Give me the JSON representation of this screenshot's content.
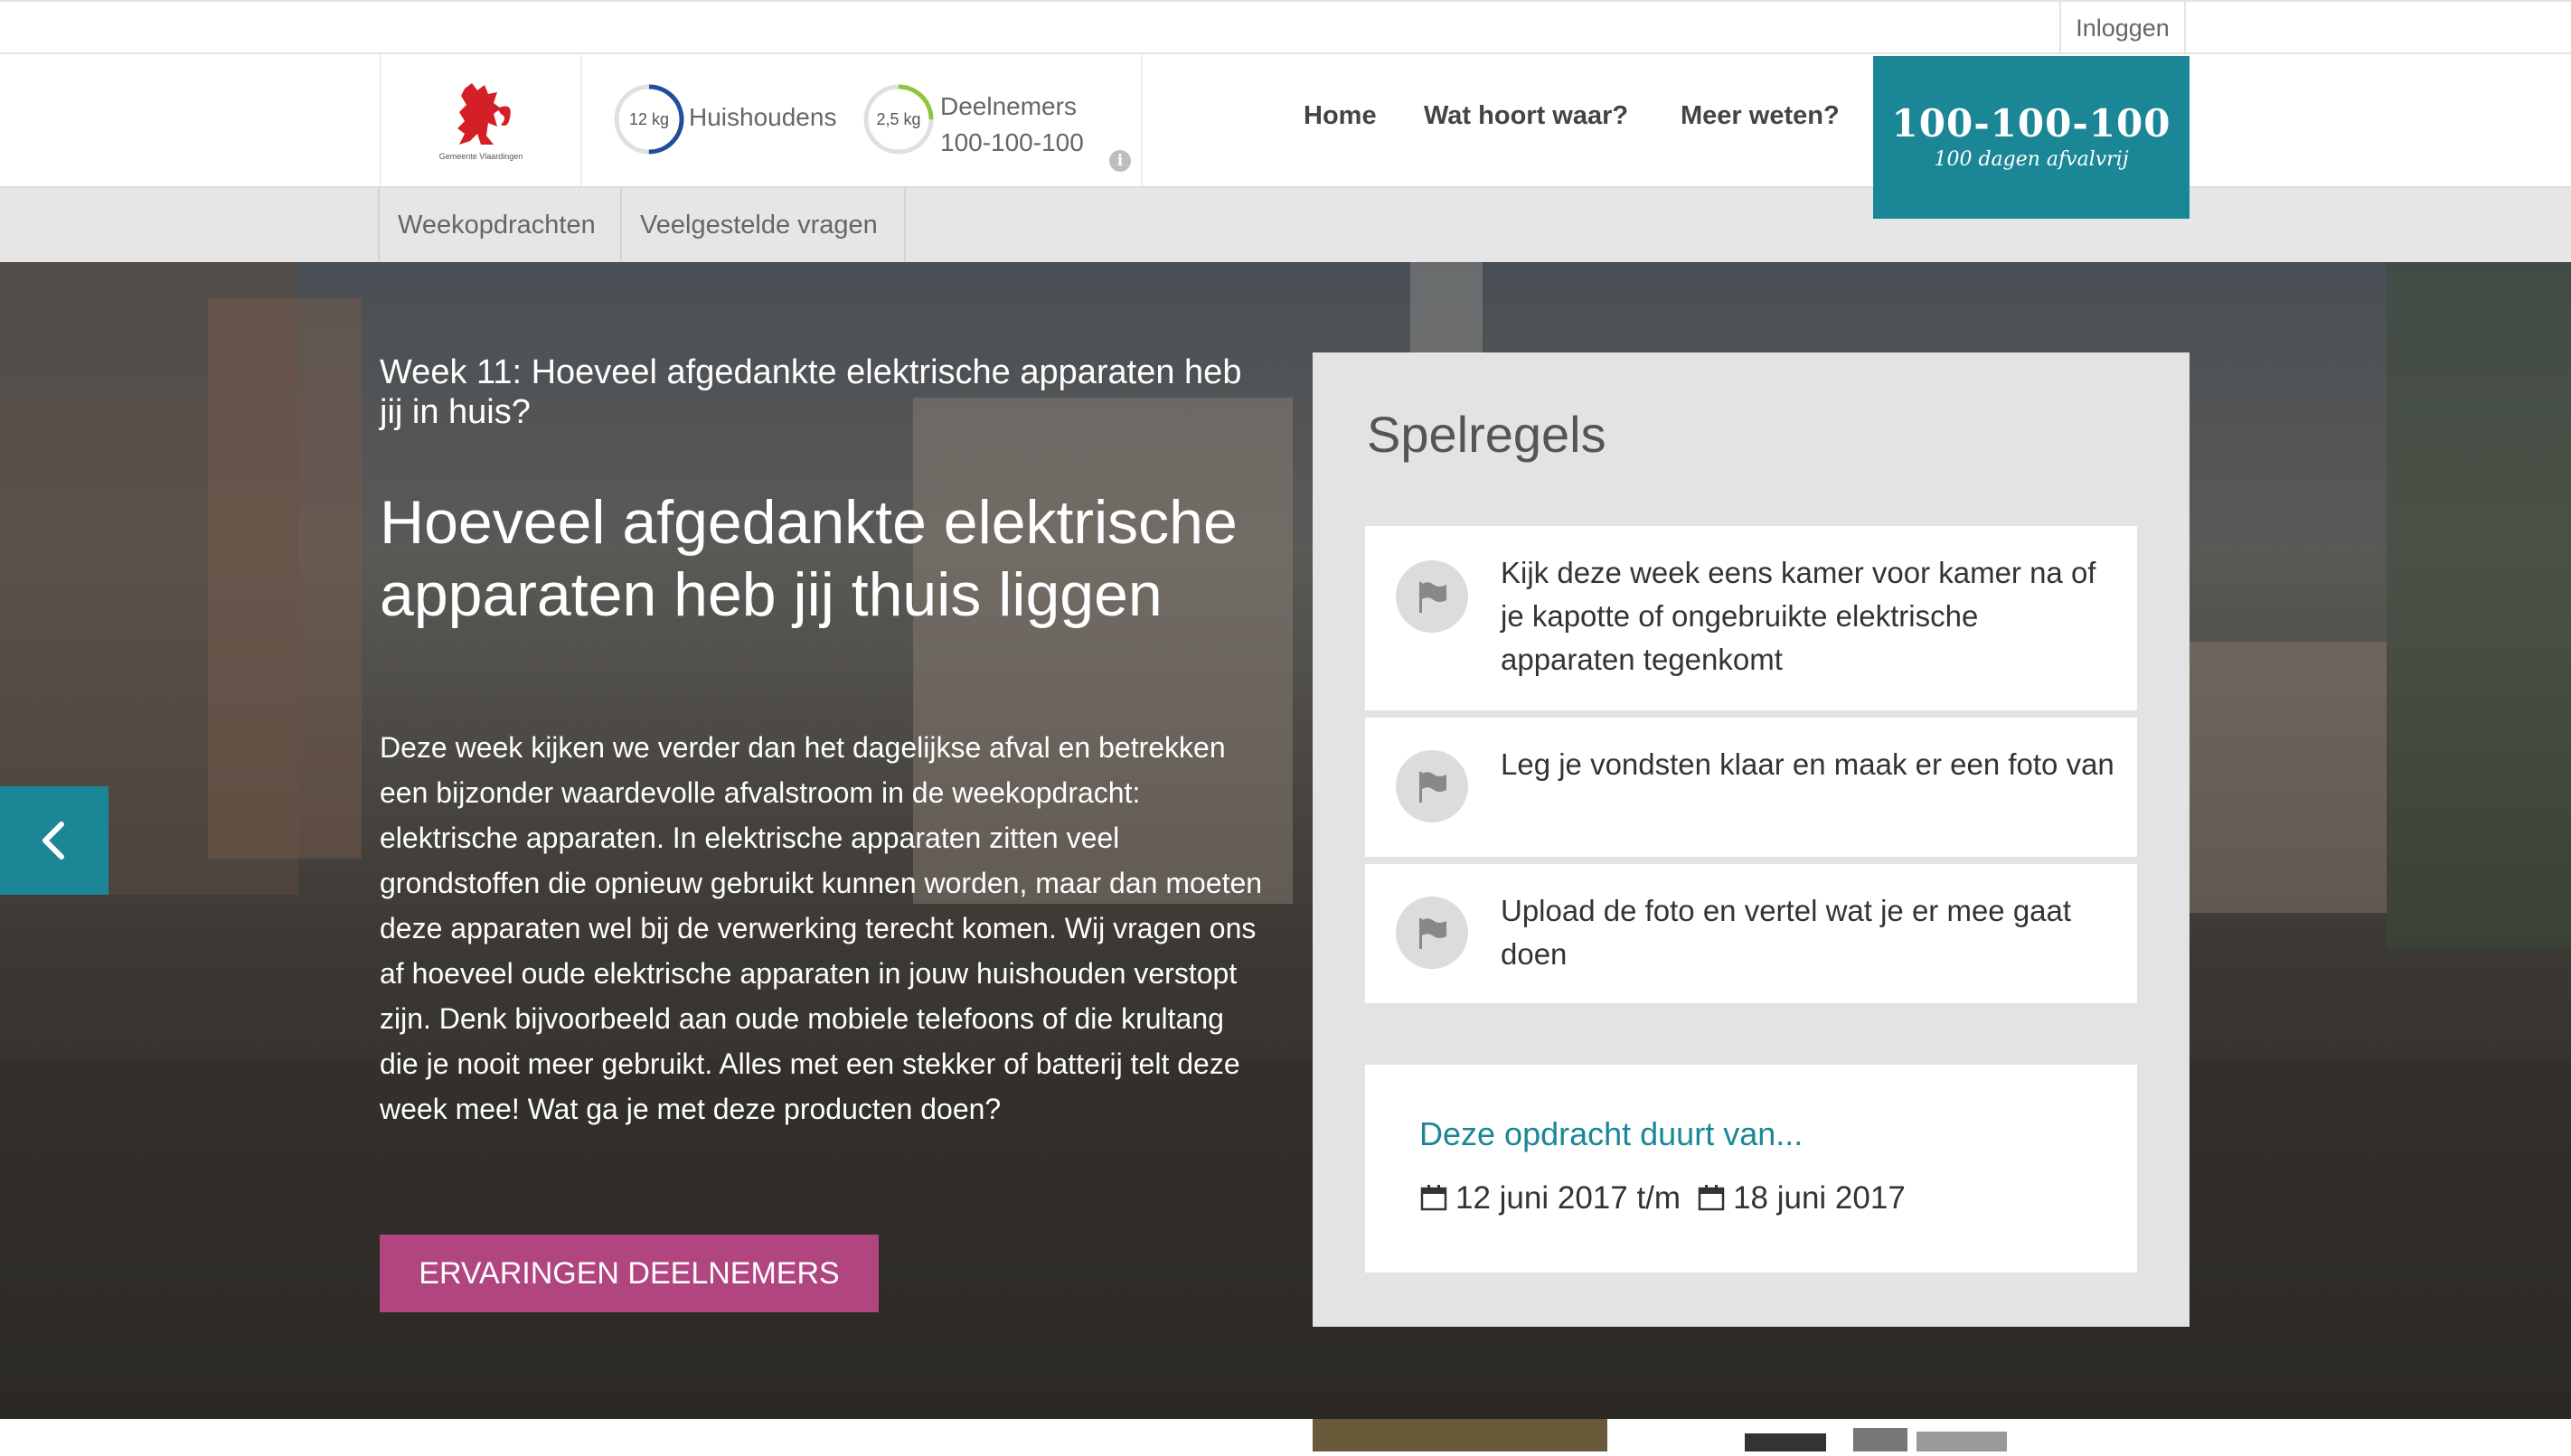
{
  "topbar": {
    "login": "Inloggen"
  },
  "header": {
    "logo_caption": "Gemeente Vlaardingen",
    "stats": [
      {
        "value": "12 kg",
        "label": "Huishoudens",
        "sub": "",
        "progress": 0.5,
        "color": "#1f4e9c"
      },
      {
        "value": "2,5 kg",
        "label": "Deelnemers",
        "sub": "100-100-100",
        "progress": 0.25,
        "color": "#8dc63f"
      }
    ],
    "info_icon": "info-icon",
    "nav": [
      "Home",
      "Wat hoort waar?",
      "Meer weten?"
    ],
    "brand": {
      "title": "100-100-100",
      "subtitle": "100 dagen afvalvrij",
      "color": "#1b8796"
    }
  },
  "subnav": [
    "Weekopdrachten",
    "Veelgestelde vragen"
  ],
  "hero": {
    "week_title": "Week 11: Hoeveel afgedankte elektrische apparaten heb jij in huis?",
    "heading": "Hoeveel afgedankte elektrische apparaten heb jij thuis liggen",
    "body": "Deze week kijken we verder dan het dagelijkse afval en betrekken een bijzonder waardevolle afvalstroom in de weekopdracht: elektrische apparaten. In elektrische apparaten zitten veel grondstoffen die opnieuw gebruikt kunnen worden, maar dan moeten deze apparaten wel bij de verwerking terecht komen. Wij vragen ons af hoeveel oude elektrische apparaten in jouw huishouden verstopt zijn. Denk bijvoorbeeld aan oude mobiele telefoons of die krultang die je nooit meer gebruikt. Alles met een stekker of batterij telt deze week mee! Wat ga je met deze producten doen?",
    "cta": "ERVARINGEN DEELNEMERS",
    "cta_color": "#b0457f"
  },
  "rules": {
    "title": "Spelregels",
    "items": [
      "Kijk deze week eens kamer voor kamer na of je kapotte of ongebruikte elektrische apparaten tegenkomt",
      "Leg je vondsten klaar en maak er een foto van",
      "Upload de foto en vertel wat je er mee gaat doen"
    ],
    "duration_title": "Deze opdracht duurt van...",
    "start_date": "12 juni 2017 t/m",
    "end_date": "18 juni 2017"
  }
}
